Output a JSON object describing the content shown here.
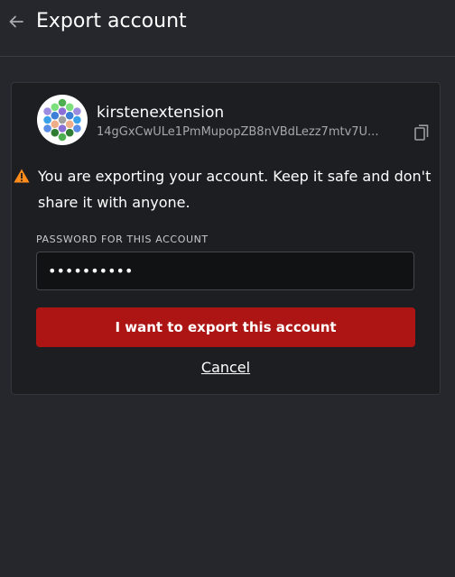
{
  "header": {
    "back_icon": "arrow-left-icon",
    "title": "Export account"
  },
  "account": {
    "avatar_icon": "polkadot-identicon",
    "name": "kirstenextension",
    "address": "14gGxCwULe1PmMupopZB8nVBdLezz7mtv7U...",
    "copy_icon": "copy-icon"
  },
  "warning": {
    "icon": "warning-triangle-icon",
    "text": "You are exporting your account. Keep it safe and don't share it with anyone."
  },
  "password": {
    "label": "PASSWORD FOR THIS ACCOUNT",
    "value": "••••••••••"
  },
  "actions": {
    "export_label": "I want to export this account",
    "cancel_label": "Cancel"
  },
  "colors": {
    "background": "#26272c",
    "card": "#1d1e22",
    "danger": "#ad1515",
    "warning": "#ff8c1a"
  }
}
